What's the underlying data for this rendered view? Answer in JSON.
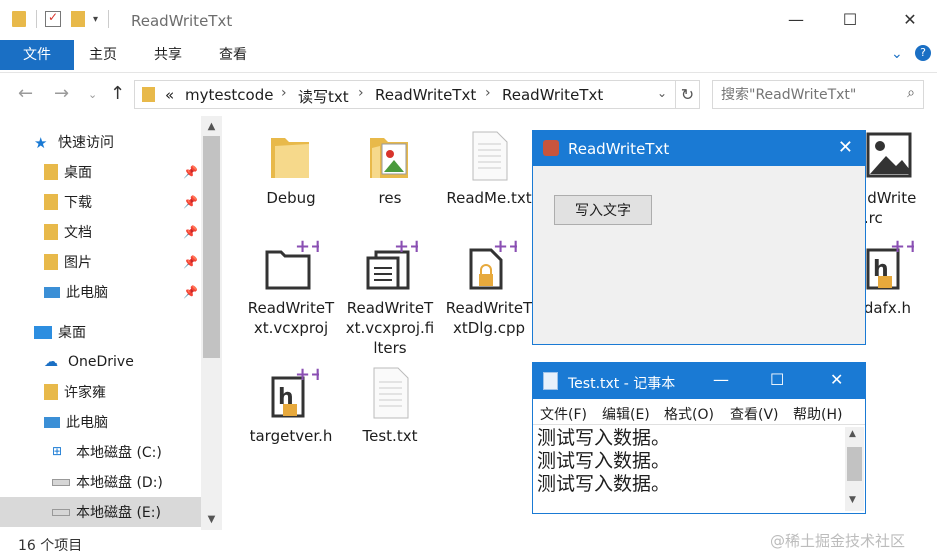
{
  "explorer": {
    "title": "ReadWriteTxt",
    "ribbon_tabs": [
      "文件",
      "主页",
      "共享",
      "查看"
    ],
    "breadcrumb": [
      "«",
      "mytestcode",
      "读写txt",
      "ReadWriteTxt",
      "ReadWriteTxt"
    ],
    "search_placeholder": "搜索\"ReadWriteTxt\"",
    "status_text": "16 个项目",
    "accent_color": "#1a6fc4"
  },
  "nav_pane": {
    "items": [
      {
        "label": "快速访问",
        "icon": "star-icon",
        "pinned": false
      },
      {
        "label": "桌面",
        "icon": "folder-icon",
        "pinned": true
      },
      {
        "label": "下载",
        "icon": "download-folder-icon",
        "pinned": true
      },
      {
        "label": "文档",
        "icon": "document-folder-icon",
        "pinned": true
      },
      {
        "label": "图片",
        "icon": "picture-folder-icon",
        "pinned": true
      },
      {
        "label": "此电脑",
        "icon": "computer-icon",
        "pinned": true
      },
      {
        "label": "桌面",
        "icon": "desktop-icon",
        "pinned": false
      },
      {
        "label": "OneDrive",
        "icon": "cloud-icon",
        "pinned": false
      },
      {
        "label": "许家雍",
        "icon": "user-folder-icon",
        "pinned": false
      },
      {
        "label": "此电脑",
        "icon": "computer-icon",
        "pinned": false
      },
      {
        "label": "本地磁盘 (C:)",
        "icon": "windows-drive-icon",
        "pinned": false
      },
      {
        "label": "本地磁盘 (D:)",
        "icon": "drive-icon",
        "pinned": false
      },
      {
        "label": "本地磁盘 (E:)",
        "icon": "drive-icon",
        "pinned": false
      }
    ]
  },
  "files": [
    {
      "name": "Debug",
      "icon": "folder-icon"
    },
    {
      "name": "res",
      "icon": "image-folder-icon"
    },
    {
      "name": "ReadMe.txt",
      "icon": "text-file-icon"
    },
    {
      "name": "ReadWriteTxt.vcxproj",
      "icon": "vcxproj-icon"
    },
    {
      "name": "ReadWriteTxt.vcxproj.filters",
      "icon": "filters-icon"
    },
    {
      "name": "ReadWriteTxtDlg.cpp",
      "icon": "cpp-file-icon"
    },
    {
      "name": "targetver.h",
      "icon": "header-file-icon"
    },
    {
      "name": "Test.txt",
      "icon": "text-file-icon"
    },
    {
      "name": "adWrite\nt.rc",
      "icon": "image-file-icon"
    },
    {
      "name": "tdafx.h",
      "icon": "header-file-icon"
    }
  ],
  "dialog": {
    "title": "ReadWriteTxt",
    "button_label": "写入文字"
  },
  "notepad": {
    "title": "Test.txt - 记事本",
    "menus": [
      "文件(F)",
      "编辑(E)",
      "格式(O)",
      "查看(V)",
      "帮助(H)"
    ],
    "lines": [
      "测试写入数据。",
      "测试写入数据。",
      "测试写入数据。"
    ]
  },
  "watermark": "@稀土掘金技术社区"
}
